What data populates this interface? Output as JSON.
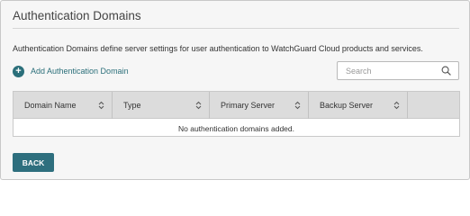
{
  "page": {
    "title": "Authentication Domains",
    "description": "Authentication Domains define server settings for user authentication to WatchGuard Cloud products and services."
  },
  "toolbar": {
    "add_label": "Add Authentication Domain",
    "add_icon": "plus-circle-icon"
  },
  "search": {
    "placeholder": "Search",
    "value": "",
    "icon": "search-icon"
  },
  "table": {
    "columns": [
      {
        "label": "Domain Name",
        "sortable": true
      },
      {
        "label": "Type",
        "sortable": true
      },
      {
        "label": "Primary Server",
        "sortable": true
      },
      {
        "label": "Backup Server",
        "sortable": true
      },
      {
        "label": "",
        "sortable": false
      }
    ],
    "empty_message": "No authentication domains added."
  },
  "footer": {
    "back_label": "BACK"
  },
  "colors": {
    "accent": "#2b6f7a",
    "button": "#2e6f7e",
    "header_bg": "#dcdcdc",
    "page_bg": "#f6f6f6"
  }
}
